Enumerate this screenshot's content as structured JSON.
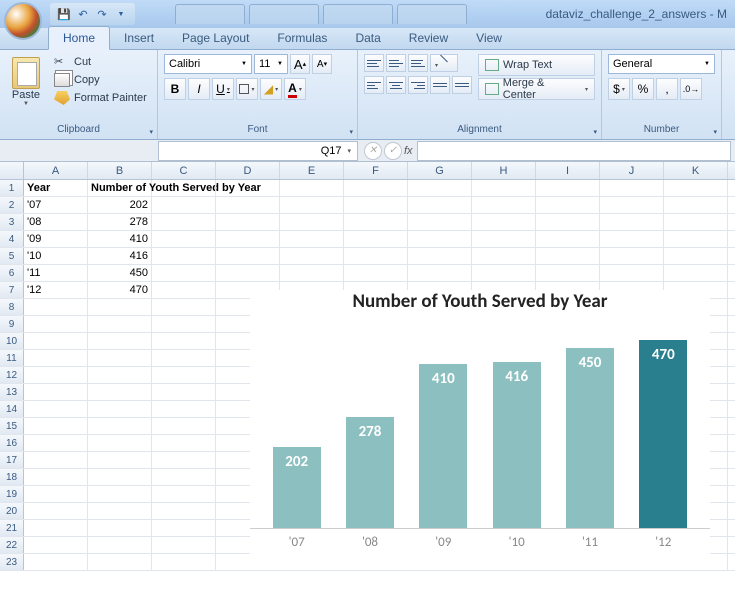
{
  "window": {
    "title": "dataviz_challenge_2_answers - M"
  },
  "ribbon": {
    "tabs": [
      "Home",
      "Insert",
      "Page Layout",
      "Formulas",
      "Data",
      "Review",
      "View"
    ],
    "active_tab": "Home",
    "clipboard": {
      "paste": "Paste",
      "cut": "Cut",
      "copy": "Copy",
      "format_painter": "Format Painter",
      "label": "Clipboard"
    },
    "font": {
      "name": "Calibri",
      "size": "11",
      "grow": "A",
      "shrink": "A",
      "bold": "B",
      "italic": "I",
      "underline": "U",
      "label": "Font"
    },
    "alignment": {
      "wrap": "Wrap Text",
      "merge": "Merge & Center",
      "label": "Alignment"
    },
    "number": {
      "format": "General",
      "dollar": "$",
      "percent": "%",
      "comma": ",",
      "label": "Number"
    }
  },
  "namebox": "Q17",
  "sheet": {
    "cols": [
      "A",
      "B",
      "C",
      "D",
      "E",
      "F",
      "G",
      "H",
      "I",
      "J",
      "K"
    ],
    "rows": [
      {
        "n": "1",
        "A": "Year",
        "B": "Number of Youth Served by Year",
        "bold": true
      },
      {
        "n": "2",
        "A": "'07",
        "B": "202"
      },
      {
        "n": "3",
        "A": "'08",
        "B": "278"
      },
      {
        "n": "4",
        "A": "'09",
        "B": "410"
      },
      {
        "n": "5",
        "A": "'10",
        "B": "416"
      },
      {
        "n": "6",
        "A": "'11",
        "B": "450"
      },
      {
        "n": "7",
        "A": "'12",
        "B": "470"
      },
      {
        "n": "8"
      },
      {
        "n": "9"
      },
      {
        "n": "10"
      },
      {
        "n": "11"
      },
      {
        "n": "12"
      },
      {
        "n": "13"
      },
      {
        "n": "14"
      },
      {
        "n": "15"
      },
      {
        "n": "16"
      },
      {
        "n": "17"
      },
      {
        "n": "18"
      },
      {
        "n": "19"
      },
      {
        "n": "20"
      },
      {
        "n": "21"
      },
      {
        "n": "22"
      },
      {
        "n": "23"
      }
    ]
  },
  "chart_data": {
    "type": "bar",
    "title": "Number of Youth Served by Year",
    "categories": [
      "'07",
      "'08",
      "'09",
      "'10",
      "'11",
      "'12"
    ],
    "values": [
      202,
      278,
      410,
      416,
      450,
      470
    ],
    "highlight_index": 5,
    "ylim": [
      0,
      500
    ],
    "xlabel": "",
    "ylabel": ""
  }
}
